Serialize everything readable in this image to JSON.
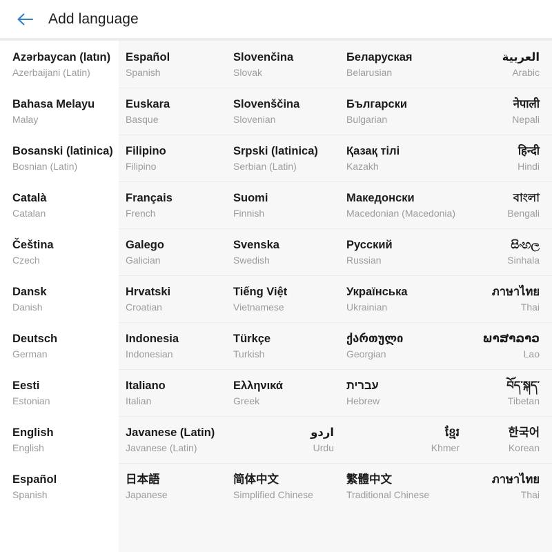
{
  "header": {
    "title": "Add language",
    "back_icon": "back-arrow-icon",
    "accent_color": "#2f7de1"
  },
  "colors": {
    "first_column_bg": "#ffffff",
    "grid_bg": "#f7f7f7",
    "native_text": "#1b1b1b",
    "english_text": "#9c9c9c",
    "divider": "#ececec"
  },
  "grid": {
    "columns": 5,
    "rows": [
      [
        {
          "native": "Azərbaycan (latın)",
          "english": "Azerbaijani (Latin)",
          "align": "left"
        },
        {
          "native": "Español",
          "english": "Spanish",
          "align": "left"
        },
        {
          "native": "Slovenčina",
          "english": "Slovak",
          "align": "left"
        },
        {
          "native": "Беларуская",
          "english": "Belarusian",
          "align": "left"
        },
        {
          "native": "العربية",
          "english": "Arabic",
          "align": "right"
        }
      ],
      [
        {
          "native": "Bahasa Melayu",
          "english": "Malay",
          "align": "left"
        },
        {
          "native": "Euskara",
          "english": "Basque",
          "align": "left"
        },
        {
          "native": "Slovenščina",
          "english": "Slovenian",
          "align": "left"
        },
        {
          "native": "Български",
          "english": "Bulgarian",
          "align": "left"
        },
        {
          "native": "नेपाली",
          "english": "Nepali",
          "align": "right"
        }
      ],
      [
        {
          "native": "Bosanski (latinica)",
          "english": "Bosnian (Latin)",
          "align": "left"
        },
        {
          "native": "Filipino",
          "english": "Filipino",
          "align": "left"
        },
        {
          "native": "Srpski (latinica)",
          "english": "Serbian (Latin)",
          "align": "left"
        },
        {
          "native": "Қазақ тілі",
          "english": "Kazakh",
          "align": "left"
        },
        {
          "native": "हिन्दी",
          "english": "Hindi",
          "align": "right"
        }
      ],
      [
        {
          "native": "Català",
          "english": "Catalan",
          "align": "left"
        },
        {
          "native": "Français",
          "english": "French",
          "align": "left"
        },
        {
          "native": "Suomi",
          "english": "Finnish",
          "align": "center"
        },
        {
          "native": "Македонски",
          "english": "Macedonian (Macedonia)",
          "align": "left"
        },
        {
          "native": "বাংলা",
          "english": "Bengali",
          "align": "right"
        }
      ],
      [
        {
          "native": "Čeština",
          "english": "Czech",
          "align": "left"
        },
        {
          "native": "Galego",
          "english": "Galician",
          "align": "left"
        },
        {
          "native": "Svenska",
          "english": "Swedish",
          "align": "left"
        },
        {
          "native": "Русский",
          "english": "Russian",
          "align": "left"
        },
        {
          "native": "සිංහල",
          "english": "Sinhala",
          "align": "right"
        }
      ],
      [
        {
          "native": "Dansk",
          "english": "Danish",
          "align": "left"
        },
        {
          "native": "Hrvatski",
          "english": "Croatian",
          "align": "left"
        },
        {
          "native": "Tiếng Việt",
          "english": "Vietnamese",
          "align": "center"
        },
        {
          "native": "Українська",
          "english": "Ukrainian",
          "align": "left"
        },
        {
          "native": "ภาษาไทย",
          "english": "Thai",
          "align": "right"
        }
      ],
      [
        {
          "native": "Deutsch",
          "english": "German",
          "align": "left"
        },
        {
          "native": "Indonesia",
          "english": "Indonesian",
          "align": "left"
        },
        {
          "native": "Türkçe",
          "english": "Turkish",
          "align": "left"
        },
        {
          "native": "ქართული",
          "english": "Georgian",
          "align": "left"
        },
        {
          "native": "ພາສາລາວ",
          "english": "Lao",
          "align": "right"
        }
      ],
      [
        {
          "native": "Eesti",
          "english": "Estonian",
          "align": "left"
        },
        {
          "native": "Italiano",
          "english": "Italian",
          "align": "left"
        },
        {
          "native": "Ελληνικά",
          "english": "Greek",
          "align": "left"
        },
        {
          "native": "עברית",
          "english": "Hebrew",
          "align": "left"
        },
        {
          "native": "བོད་སྐད་",
          "english": "Tibetan",
          "align": "right"
        }
      ],
      [
        {
          "native": "English",
          "english": "English",
          "align": "left"
        },
        {
          "native": "Javanese (Latin)",
          "english": "Javanese (Latin)",
          "align": "left"
        },
        {
          "native": "اردو",
          "english": "Urdu",
          "align": "right"
        },
        {
          "native": "ខ្មែរ",
          "english": "Khmer",
          "align": "right"
        },
        {
          "native": "한국어",
          "english": "Korean",
          "align": "right"
        }
      ],
      [
        {
          "native": "Español",
          "english": "Spanish",
          "align": "left"
        },
        {
          "native": "日本語",
          "english": "Japanese",
          "align": "left"
        },
        {
          "native": "简体中文",
          "english": "Simplified Chinese",
          "align": "left"
        },
        {
          "native": "繁體中文",
          "english": "Traditional Chinese",
          "align": "left"
        },
        {
          "native": "ภาษาไทย",
          "english": "Thai",
          "align": "right"
        }
      ]
    ]
  }
}
